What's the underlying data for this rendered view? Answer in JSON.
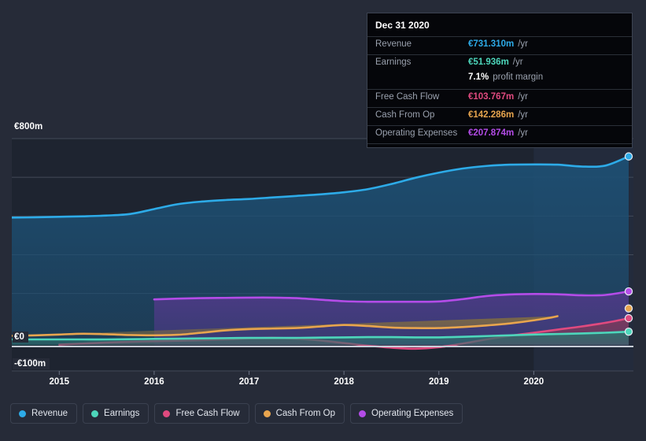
{
  "chart_data": {
    "type": "area",
    "title": "",
    "xlabel": "",
    "ylabel": "",
    "currency": "EUR",
    "units": "millions per year",
    "ylim": [
      -100,
      800
    ],
    "y_ticks": [
      {
        "value": 800,
        "label": "€800m"
      },
      {
        "value": 0,
        "label": "€0"
      },
      {
        "value": -100,
        "label": "-€100m"
      }
    ],
    "y_gridlines": [
      800,
      650,
      500,
      350,
      200,
      0,
      -100
    ],
    "x_ticks": [
      "2015",
      "2016",
      "2017",
      "2018",
      "2019",
      "2020"
    ],
    "xlim": [
      "2014-06",
      "2021-03"
    ],
    "grid": true,
    "legend_position": "bottom-left",
    "forecast_band_start": "2020-01",
    "series": [
      {
        "name": "Revenue",
        "color": "#2dabe8",
        "fill": "#1d4f73",
        "latest_value": 731.31,
        "x": [
          2014.5,
          2014.75,
          2015.0,
          2015.25,
          2015.5,
          2015.75,
          2016.0,
          2016.25,
          2016.5,
          2016.75,
          2017.0,
          2017.25,
          2017.5,
          2017.75,
          2018.0,
          2018.25,
          2018.5,
          2018.75,
          2019.0,
          2019.25,
          2019.5,
          2019.75,
          2020.0,
          2020.25,
          2020.5,
          2020.75,
          2021.0
        ],
        "values": [
          494,
          495,
          497,
          499,
          502,
          508,
          527,
          546,
          556,
          562,
          566,
          572,
          578,
          584,
          592,
          604,
          624,
          648,
          668,
          684,
          694,
          699,
          700,
          699,
          692,
          695,
          731
        ]
      },
      {
        "name": "Earnings",
        "color": "#4dd6bb",
        "fill": "#2f6f6d",
        "latest_value": 51.936,
        "x": [
          2014.5,
          2014.75,
          2015.0,
          2015.25,
          2015.5,
          2015.75,
          2016.0,
          2016.25,
          2016.5,
          2016.75,
          2017.0,
          2017.25,
          2017.5,
          2017.75,
          2018.0,
          2018.25,
          2018.5,
          2018.75,
          2019.0,
          2019.25,
          2019.5,
          2019.75,
          2020.0,
          2020.25,
          2020.5,
          2020.75,
          2021.0
        ],
        "values": [
          22,
          22,
          22,
          22,
          22,
          23,
          24,
          25,
          26,
          27,
          28,
          28,
          28,
          29,
          30,
          31,
          31,
          30,
          30,
          32,
          35,
          38,
          41,
          43,
          45,
          48,
          52
        ]
      },
      {
        "name": "Free Cash Flow",
        "color": "#e04a7f",
        "fill": "#7a3a5c",
        "latest_value": 103.767,
        "x": [
          2015.0,
          2015.25,
          2015.5,
          2015.75,
          2016.0,
          2016.25,
          2016.5,
          2016.75,
          2017.0,
          2017.25,
          2017.5,
          2017.75,
          2018.0,
          2018.25,
          2018.5,
          2018.75,
          2019.0,
          2019.25,
          2019.5,
          2019.75,
          2020.0,
          2020.25,
          2020.5,
          2020.75,
          2021.0
        ],
        "values": [
          2,
          6,
          10,
          13,
          15,
          17,
          19,
          22,
          26,
          28,
          25,
          18,
          8,
          -2,
          -10,
          -14,
          -8,
          6,
          22,
          36,
          48,
          60,
          72,
          86,
          104
        ]
      },
      {
        "name": "Cash From Op",
        "color": "#e8a54e",
        "fill": "#7d6a44",
        "latest_value": 142.286,
        "x": [
          2014.5,
          2014.75,
          2015.0,
          2015.25,
          2015.5,
          2015.75,
          2016.0,
          2016.25,
          2016.5,
          2016.75,
          2017.0,
          2017.25,
          2017.5,
          2017.75,
          2018.0,
          2018.25,
          2018.5,
          2018.75,
          2019.0,
          2019.25,
          2019.5,
          2019.75,
          2020.0,
          2020.25,
          2020.5,
          2020.75,
          2021.0
        ],
        "values": [
          36,
          38,
          41,
          44,
          42,
          39,
          38,
          40,
          48,
          57,
          62,
          64,
          66,
          72,
          78,
          74,
          68,
          66,
          66,
          70,
          76,
          84,
          96,
          112,
          142
        ]
      },
      {
        "name": "Operating Expenses",
        "color": "#b44ce8",
        "fill": "#4d3a86",
        "latest_value": 207.874,
        "x": [
          2016.0,
          2016.25,
          2016.5,
          2016.75,
          2017.0,
          2017.25,
          2017.5,
          2017.75,
          2018.0,
          2018.25,
          2018.5,
          2018.75,
          2019.0,
          2019.25,
          2019.5,
          2019.75,
          2020.0,
          2020.25,
          2020.5,
          2020.75,
          2021.0
        ],
        "values": [
          177,
          180,
          182,
          183,
          184,
          184,
          182,
          176,
          170,
          168,
          168,
          168,
          169,
          178,
          190,
          196,
          198,
          197,
          193,
          194,
          208
        ]
      }
    ]
  },
  "tooltip": {
    "title": "Dec 31 2020",
    "rows": [
      {
        "key": "Revenue",
        "value": "€731.310m",
        "unit": "/yr",
        "color": "#2dabe8"
      },
      {
        "key": "Earnings",
        "value": "€51.936m",
        "unit": "/yr",
        "color": "#4dd6bb"
      },
      {
        "key": "",
        "value": "7.1%",
        "unit": "profit margin",
        "color": "#ffffff"
      },
      {
        "key": "Free Cash Flow",
        "value": "€103.767m",
        "unit": "/yr",
        "color": "#e04a7f"
      },
      {
        "key": "Cash From Op",
        "value": "€142.286m",
        "unit": "/yr",
        "color": "#e8a54e"
      },
      {
        "key": "Operating Expenses",
        "value": "€207.874m",
        "unit": "/yr",
        "color": "#b44ce8"
      }
    ]
  },
  "axis": {
    "y_top_label": "€800m",
    "y_zero_label": "€0",
    "y_bottom_label": "-€100m",
    "x_labels": [
      "2015",
      "2016",
      "2017",
      "2018",
      "2019",
      "2020"
    ]
  },
  "legend": {
    "items": [
      {
        "label": "Revenue",
        "color": "#2dabe8"
      },
      {
        "label": "Earnings",
        "color": "#4dd6bb"
      },
      {
        "label": "Free Cash Flow",
        "color": "#e04a7f"
      },
      {
        "label": "Cash From Op",
        "color": "#e8a54e"
      },
      {
        "label": "Operating Expenses",
        "color": "#b44ce8"
      }
    ]
  }
}
